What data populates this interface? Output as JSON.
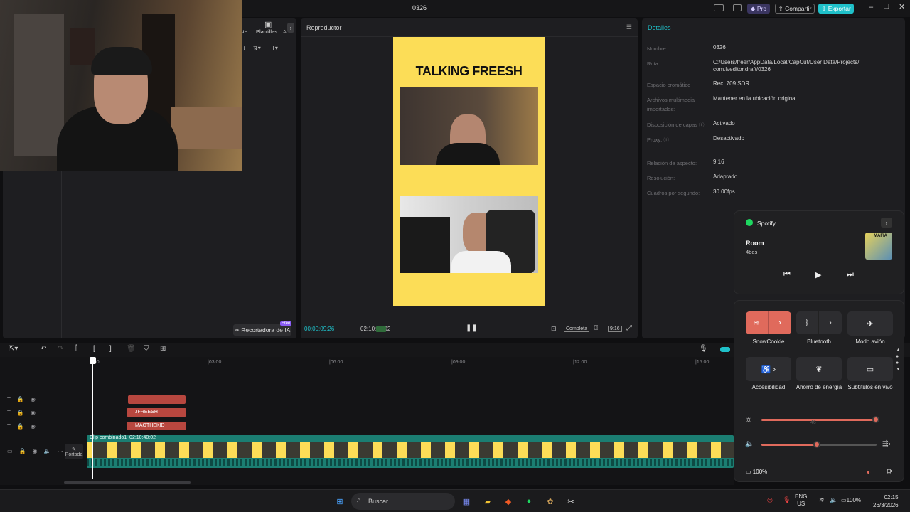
{
  "titlebar": {
    "project": "0326",
    "pro_label": "Pro",
    "share_label": "Compartir",
    "export_label": "Exportar",
    "accent": "#1fc0c9"
  },
  "media_panel": {
    "tab_partial": "ste",
    "tab_templates": "Plantillas",
    "tab_more": "A"
  },
  "player": {
    "title": "Reproductor",
    "video_title": "TALKING FREESH",
    "time_current": "00:00:09:26",
    "time_total": "02:10:40:02",
    "full_label": "Completa",
    "ratio_label": "9:16",
    "ai_button": "Recortadora de IA",
    "ai_badge": "Free"
  },
  "details": {
    "title": "Detalles",
    "rows": [
      {
        "k": "Nombre:",
        "v": "0326"
      },
      {
        "k": "Ruta:",
        "v": "C:/Users/freer/AppData/Local/CapCut/User Data/Projects/\ncom.lveditor.draft/0326"
      },
      {
        "k": "Espacio cromático",
        "v": "Rec. 709 SDR"
      },
      {
        "k": "Archivos multimedia importados:",
        "v": "Mantener en la ubicación original"
      },
      {
        "k": "Disposición de capas ⓘ",
        "v": "Activado"
      },
      {
        "k": "Proxy: ⓘ",
        "v": "Desactivado"
      },
      {
        "k": "Relación de aspecto:",
        "v": "9:16"
      },
      {
        "k": "Resolución:",
        "v": "Adaptado"
      },
      {
        "k": "Cuadros por segundo:",
        "v": "30.00fps"
      }
    ]
  },
  "timeline": {
    "ticks": [
      "|03:00",
      "|06:00",
      "|09:00",
      "|12:00",
      "|15:00"
    ],
    "clips": {
      "text1": "",
      "text2": "JFREESH",
      "text3": "MAOTHEKID",
      "main_label": "Clip combinado1",
      "main_duration": "02:10:40:02"
    },
    "cover_label": "Portada"
  },
  "spotify": {
    "app": "Spotify",
    "song": "Room",
    "artist": "4bes",
    "art_text": "MAFIA"
  },
  "quick_settings": {
    "tiles": [
      {
        "label": "SnowCookie"
      },
      {
        "label": "Bluetooth"
      },
      {
        "label": "Modo avión"
      },
      {
        "label": "Accesibilidad"
      },
      {
        "label": "Ahorro de energía"
      },
      {
        "label": "Subtítulos en vivo"
      }
    ],
    "brightness": 1.0,
    "brightness_hint": "46",
    "volume": 0.48,
    "battery": "100%",
    "accent": "#e06a5c"
  },
  "taskbar": {
    "search": "Buscar",
    "lang1": "ENG",
    "lang2": "US",
    "battery": "100%",
    "time": "02:15",
    "date": "26/3/2026"
  }
}
